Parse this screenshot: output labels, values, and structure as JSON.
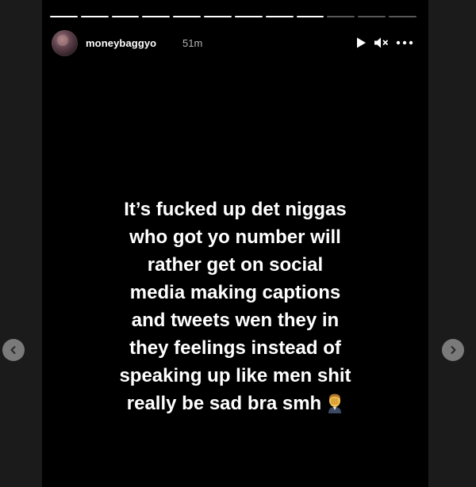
{
  "story": {
    "username": "moneybaggyo",
    "time_ago": "51m",
    "text": "It’s fucked up det niggas\nwho got yo number will\nrather get on social\nmedia making captions\nand tweets wen they in\nthey feelings instead of\nspeaking up like men shit\nreally be sad bra smh",
    "text_emoji": "man-facepalming-emoji",
    "progress": {
      "segments": 12,
      "completed": 9
    }
  },
  "controls": {
    "play_icon": "play-icon",
    "mute_icon": "muted-speaker-icon",
    "more_icon": "more-options-icon"
  },
  "navigation": {
    "prev_icon": "chevron-left-icon",
    "next_icon": "chevron-right-icon"
  },
  "colors": {
    "story_background": "#000000",
    "page_background": "#1b1b1b",
    "text": "#ffffff",
    "nav_button": "#7a7a7a"
  }
}
